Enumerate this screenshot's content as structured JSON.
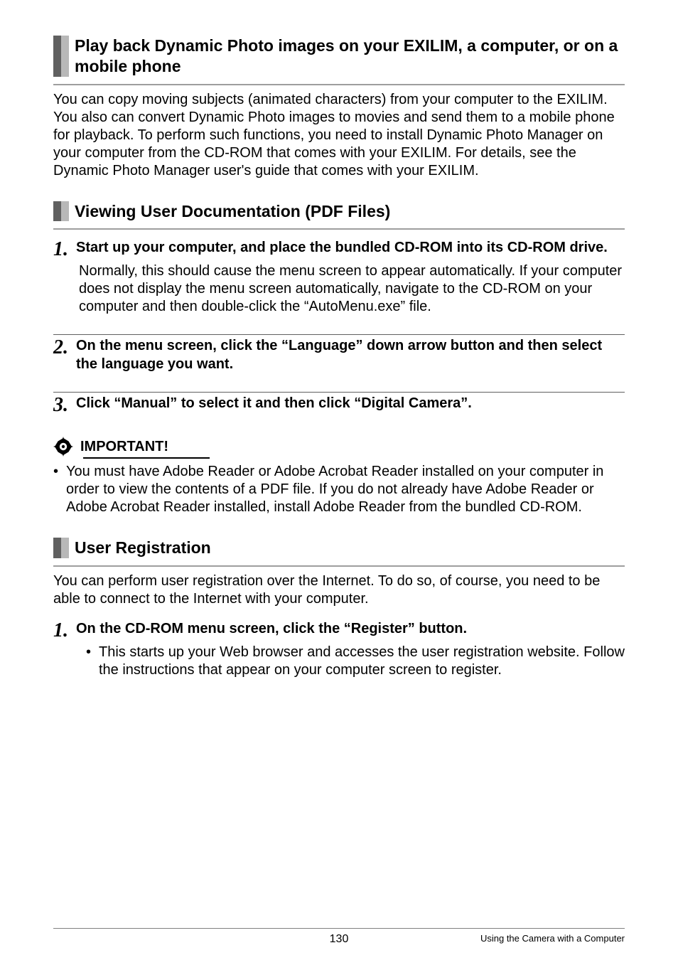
{
  "sections": {
    "play_back": {
      "title": "Play back Dynamic Photo images on your EXILIM, a computer, or on a mobile phone",
      "body": "You can copy moving subjects (animated characters) from your computer to the EXILIM. You also can convert Dynamic Photo images to movies and send them to a mobile phone for playback. To perform such functions, you need to install Dynamic Photo Manager on your computer from the CD-ROM that comes with your EXILIM. For details, see the Dynamic Photo Manager user's guide that comes with your EXILIM."
    },
    "viewing_docs": {
      "title": "Viewing User Documentation (PDF Files)",
      "step1_num": "1.",
      "step1_text": "Start up your computer, and place the bundled CD-ROM into its CD-ROM drive.",
      "step1_detail": "Normally, this should cause the menu screen to appear automatically. If your computer does not display the menu screen automatically, navigate to the CD-ROM on your computer and then double-click the “AutoMenu.exe” file.",
      "step2_num": "2.",
      "step2_text": "On the menu screen, click the “Language” down arrow button and then select the language you want.",
      "step3_num": "3.",
      "step3_text": "Click “Manual” to select it and then click “Digital Camera”."
    },
    "important": {
      "label": "IMPORTANT!",
      "bullet": "You must have Adobe Reader or Adobe Acrobat Reader installed on your computer in order to view the contents of a PDF file. If you do not already have Adobe Reader or Adobe Acrobat Reader installed, install Adobe Reader from the bundled CD-ROM."
    },
    "user_registration": {
      "title": "User Registration",
      "body": "You can perform user registration over the Internet. To do so, of course, you need to be able to connect to the Internet with your computer.",
      "step1_num": "1.",
      "step1_text": "On the CD-ROM menu screen, click the “Register” button.",
      "step1_bullet": "This starts up your Web browser and accesses the user registration website. Follow the instructions that appear on your computer screen to register."
    }
  },
  "footer": {
    "page": "130",
    "section": "Using the Camera with a Computer"
  }
}
